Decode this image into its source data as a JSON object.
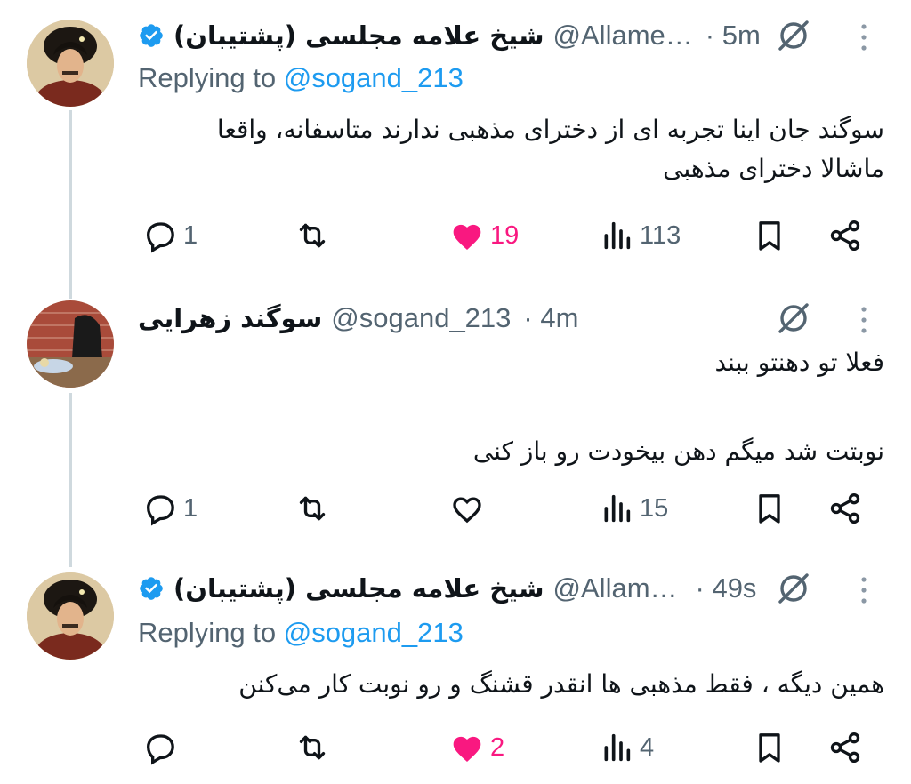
{
  "tweets": [
    {
      "name": "شیخ علامه مجلسی (پشتیبان)",
      "handle": "@Allame…",
      "time": "· 5m",
      "verified": true,
      "replying_label": "Replying to",
      "replying_to": "@sogand_213",
      "text_lines": [
        "سوگند جان اینا تجربه ای از دخترای مذهبی ندارند متاسفانه، واقعا",
        "ماشالا دخترای مذهبی"
      ],
      "replies": "1",
      "reposts": "",
      "likes": "19",
      "liked": true,
      "views": "113"
    },
    {
      "name": "سوگند زهرایی",
      "handle": "@sogand_213",
      "time": "· 4m",
      "verified": false,
      "text_lines": [
        "فعلا تو دهنتو ببند",
        "نوبتت شد میگم دهن بیخودت رو باز کنی"
      ],
      "replies": "1",
      "reposts": "",
      "likes": "",
      "liked": false,
      "views": "15"
    },
    {
      "name": "شیخ علامه مجلسی (پشتیبان)",
      "handle": "@Allam…",
      "time": "· 49s",
      "verified": true,
      "replying_label": "Replying to",
      "replying_to": "@sogand_213",
      "text_lines": [
        "همین دیگه ، فقط مذهبی ها انقدر قشنگ و رو نوبت کار می‌کنن"
      ],
      "replies": "",
      "reposts": "",
      "likes": "2",
      "liked": true,
      "views": "4"
    }
  ],
  "colors": {
    "accent": "#1d9bf0",
    "like": "#f91880",
    "secondary_text": "#536471",
    "thread_line": "#cfd9de"
  },
  "icons": [
    "verified-badge-icon",
    "grok-icon",
    "more-options-icon",
    "reply-icon",
    "repost-icon",
    "like-icon",
    "views-icon",
    "bookmark-icon",
    "share-icon"
  ]
}
